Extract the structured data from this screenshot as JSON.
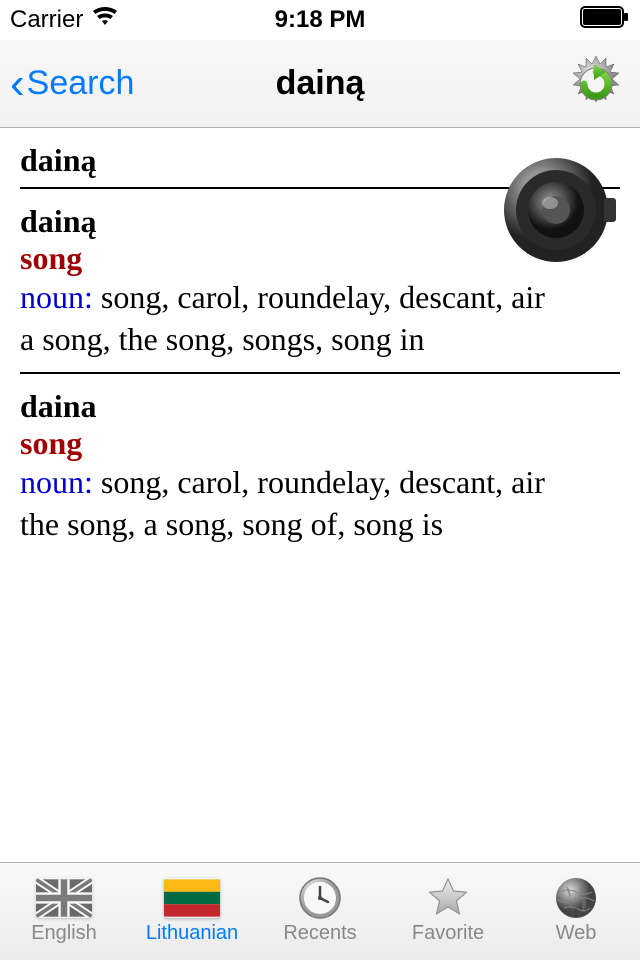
{
  "status": {
    "carrier": "Carrier",
    "time": "9:18 PM"
  },
  "nav": {
    "back_label": "Search",
    "title": "dainą"
  },
  "headword": "dainą",
  "entries": [
    {
      "word": "dainą",
      "translation": "song",
      "pos_label": "noun:",
      "synonyms": " song, carol, roundelay, descant, air",
      "examples": "a song, the song, songs, song in"
    },
    {
      "word": "daina",
      "translation": "song",
      "pos_label": "noun:",
      "synonyms": " song, carol, roundelay, descant, air",
      "examples": "the song, a song, song of, song is"
    }
  ],
  "tabs": [
    {
      "label": "English"
    },
    {
      "label": "Lithuanian"
    },
    {
      "label": "Recents"
    },
    {
      "label": "Favorite"
    },
    {
      "label": "Web"
    }
  ]
}
